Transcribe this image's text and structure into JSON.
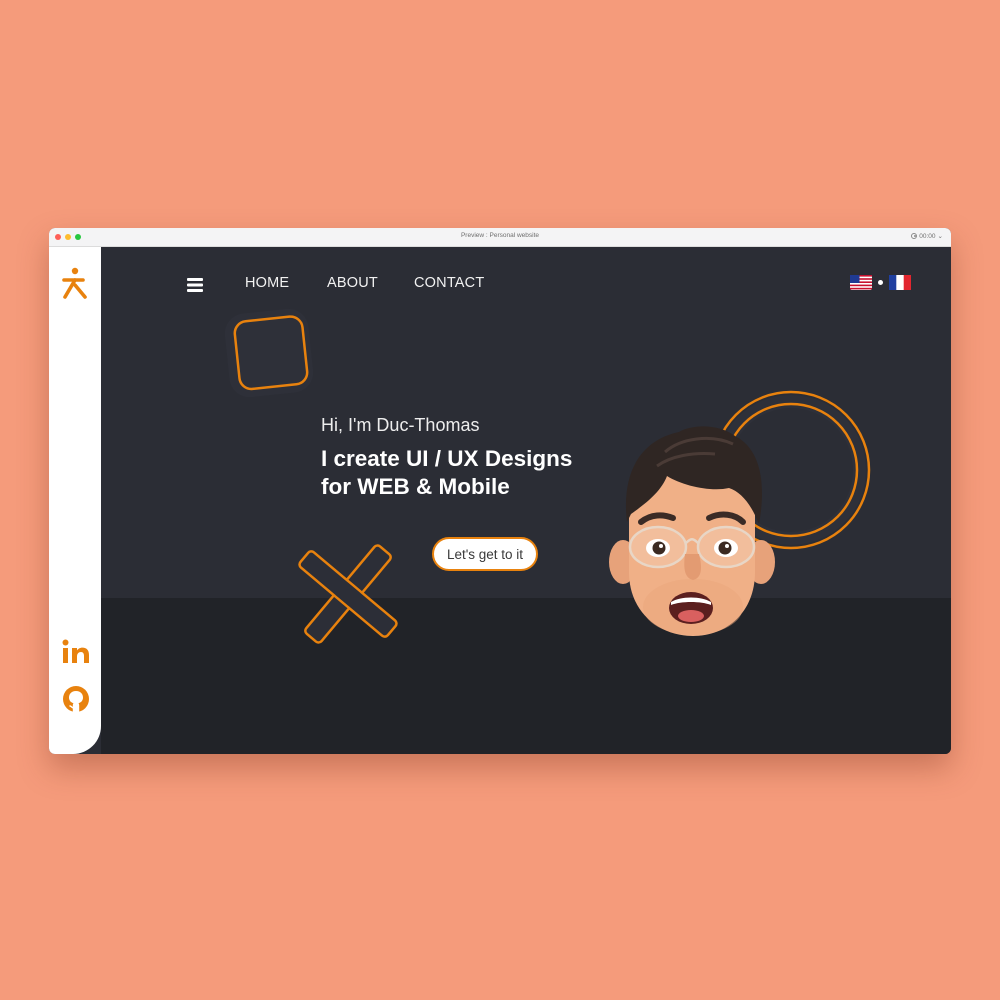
{
  "window": {
    "title": "Preview : Personal website",
    "timer": "00:00"
  },
  "sidebar": {
    "logo_icon": "k-person-logo-icon",
    "social": [
      {
        "name": "linkedin-icon"
      },
      {
        "name": "github-icon"
      }
    ]
  },
  "nav": {
    "menu_icon": "hamburger-menu-icon",
    "links": [
      "HOME",
      "ABOUT",
      "CONTACT"
    ],
    "languages": [
      {
        "name": "us-flag-icon"
      },
      {
        "name": "france-flag-icon"
      }
    ]
  },
  "hero": {
    "greeting": "Hi, I'm Duc-Thomas",
    "headline_line1": "I create UI / UX Designs",
    "headline_line2": "for WEB & Mobile",
    "cta_label": "Let's get to it",
    "avatar": "memoji-avatar"
  },
  "colors": {
    "accent": "#e8820e",
    "background": "#f59b7b",
    "hero_bg": "#2b2d35",
    "hero_bottom": "#212328",
    "sidebar": "#ffffff"
  }
}
